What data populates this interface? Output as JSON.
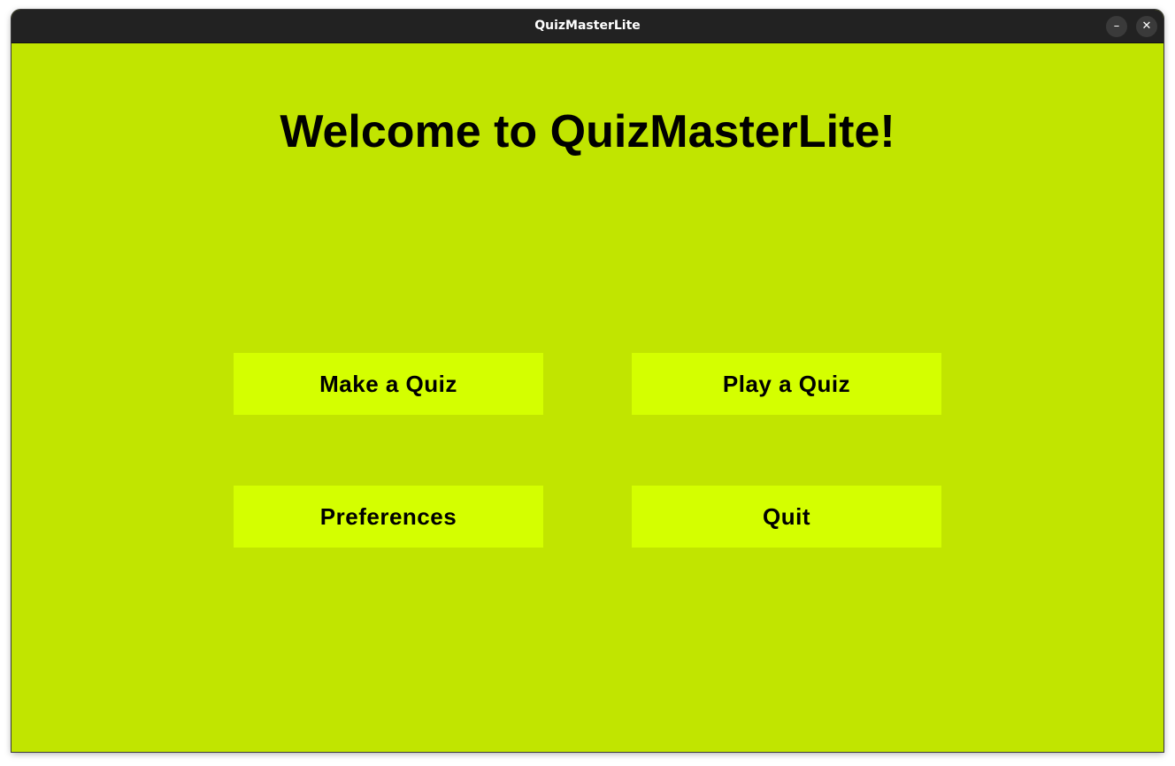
{
  "window": {
    "title": "QuizMasterLite",
    "minimize_glyph": "–",
    "close_glyph": "✕"
  },
  "main": {
    "heading": "Welcome to QuizMasterLite!",
    "buttons": {
      "make_quiz": "Make a Quiz",
      "play_quiz": "Play a Quiz",
      "preferences": "Preferences",
      "quit": "Quit"
    }
  },
  "colors": {
    "background": "#c1e500",
    "button_background": "#d4ff00",
    "titlebar": "#222222",
    "text": "#000000"
  }
}
